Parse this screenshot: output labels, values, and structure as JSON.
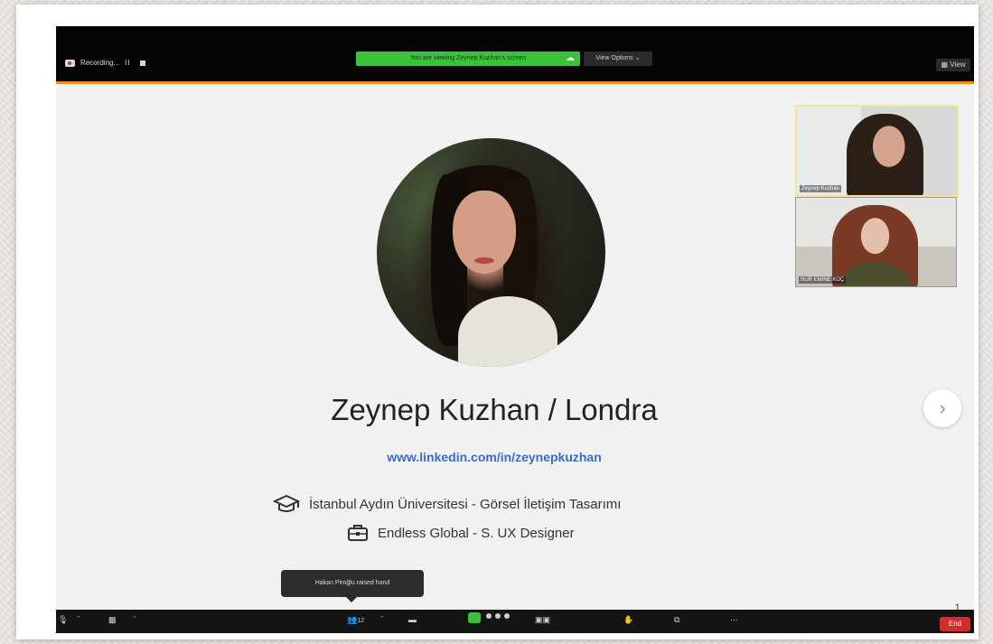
{
  "top_bar": {
    "recording_label": "Recording...",
    "pause_glyph": "II",
    "sharing_banner": "You are viewing Zeynep Kuzhan's screen",
    "view_options": "View Options ⌄",
    "view_label": "View"
  },
  "slide": {
    "title": "Zeynep Kuzhan / Londra",
    "link": "www.linkedin.com/in/zeynepkuzhan",
    "education": "İstanbul Aydın Üniversitesi - Görsel İletişim Tasarımı",
    "job": "Endless Global - S. UX Designer",
    "page_number": "1",
    "icons": {
      "education": "graduation-cap-icon",
      "job": "briefcase-icon",
      "next": "chevron-right-icon"
    }
  },
  "participants": [
    {
      "name": "Zeynep Kuzhan",
      "active_speaker": true
    },
    {
      "name": "NUR EMİNE KOÇ",
      "active_speaker": false
    }
  ],
  "notification": {
    "text": "Hakan Piroğlu raised hand"
  },
  "toolbar": {
    "participants_count": "12",
    "end_label": "End",
    "more_label": "···"
  },
  "colors": {
    "share_banner": "#3cc13c",
    "end_button": "#d62b2b",
    "link": "#3c6dbd",
    "accent_line": "#f08c1e"
  }
}
